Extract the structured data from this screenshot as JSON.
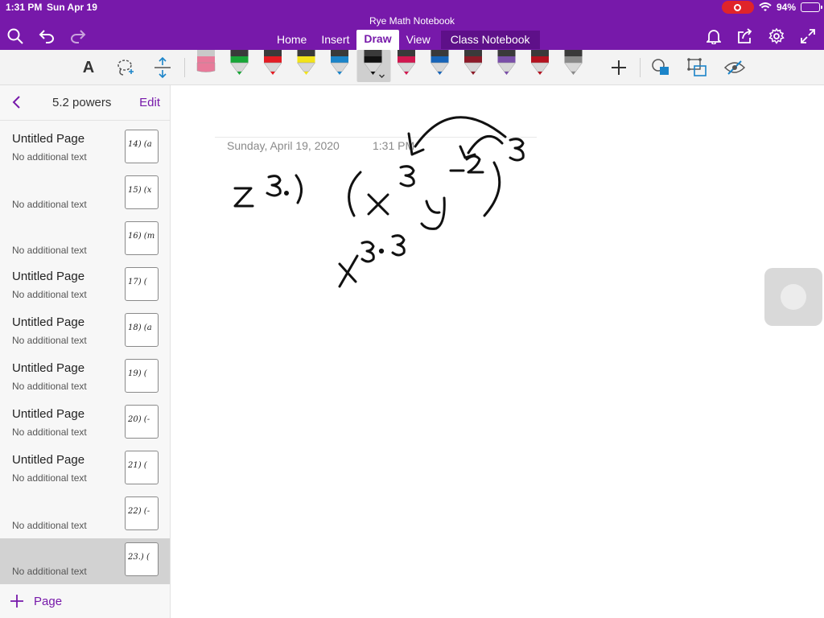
{
  "status": {
    "time": "1:31 PM",
    "date": "Sun Apr 19",
    "battery": "94%",
    "battery_level": 0.94
  },
  "header": {
    "notebook_title": "Rye Math Notebook",
    "tabs": [
      {
        "label": "Home"
      },
      {
        "label": "Insert"
      },
      {
        "label": "Draw"
      },
      {
        "label": "View"
      },
      {
        "label": "Class Notebook"
      }
    ],
    "active_tab": "Draw",
    "icons": [
      "search-icon",
      "undo-icon",
      "redo-icon",
      "bell-icon",
      "share-icon",
      "gear-icon",
      "fullscreen-icon"
    ]
  },
  "toolbar": {
    "text_tool": "A",
    "pens": [
      {
        "name": "eraser",
        "color": "#e87a9a"
      },
      {
        "name": "highlighter-green",
        "color": "#18a637"
      },
      {
        "name": "highlighter-red",
        "color": "#e31b23"
      },
      {
        "name": "highlighter-yellow",
        "color": "#f2e31a"
      },
      {
        "name": "highlighter-blue",
        "color": "#1b84c9"
      },
      {
        "name": "pen-black",
        "color": "#111111",
        "selected": true
      },
      {
        "name": "pen-pink",
        "color": "#d1174f"
      },
      {
        "name": "pen-blue",
        "color": "#1764b8"
      },
      {
        "name": "pen-darkred",
        "color": "#8c1a28"
      },
      {
        "name": "pen-galaxy",
        "color": "#7a4fa8"
      },
      {
        "name": "pen-crimson",
        "color": "#b3121f"
      },
      {
        "name": "pencil-gray",
        "color": "#8a8a8a"
      }
    ]
  },
  "sidebar": {
    "section_title": "5.2 powers",
    "edit_label": "Edit",
    "add_page_label": "Page",
    "pages": [
      {
        "title": "Untitled Page",
        "subtitle": "No additional text",
        "thumb": "14) (a"
      },
      {
        "title": "",
        "subtitle": "No additional text",
        "thumb": "15) (x"
      },
      {
        "title": "",
        "subtitle": "No additional text",
        "thumb": "16) (m"
      },
      {
        "title": "Untitled Page",
        "subtitle": "No additional text",
        "thumb": "17) ("
      },
      {
        "title": "Untitled Page",
        "subtitle": "No additional text",
        "thumb": "18) (a"
      },
      {
        "title": "Untitled Page",
        "subtitle": "No additional text",
        "thumb": "19) ("
      },
      {
        "title": "Untitled Page",
        "subtitle": "No additional text",
        "thumb": "20) (-"
      },
      {
        "title": "Untitled Page",
        "subtitle": "No additional text",
        "thumb": "21) ("
      },
      {
        "title": "",
        "subtitle": "No additional text",
        "thumb": "22) (-"
      },
      {
        "title": "",
        "subtitle": "No additional text",
        "thumb": "23.) (",
        "selected": true
      }
    ]
  },
  "page": {
    "date": "Sunday, April 19, 2020",
    "time": "1:31 PM"
  }
}
